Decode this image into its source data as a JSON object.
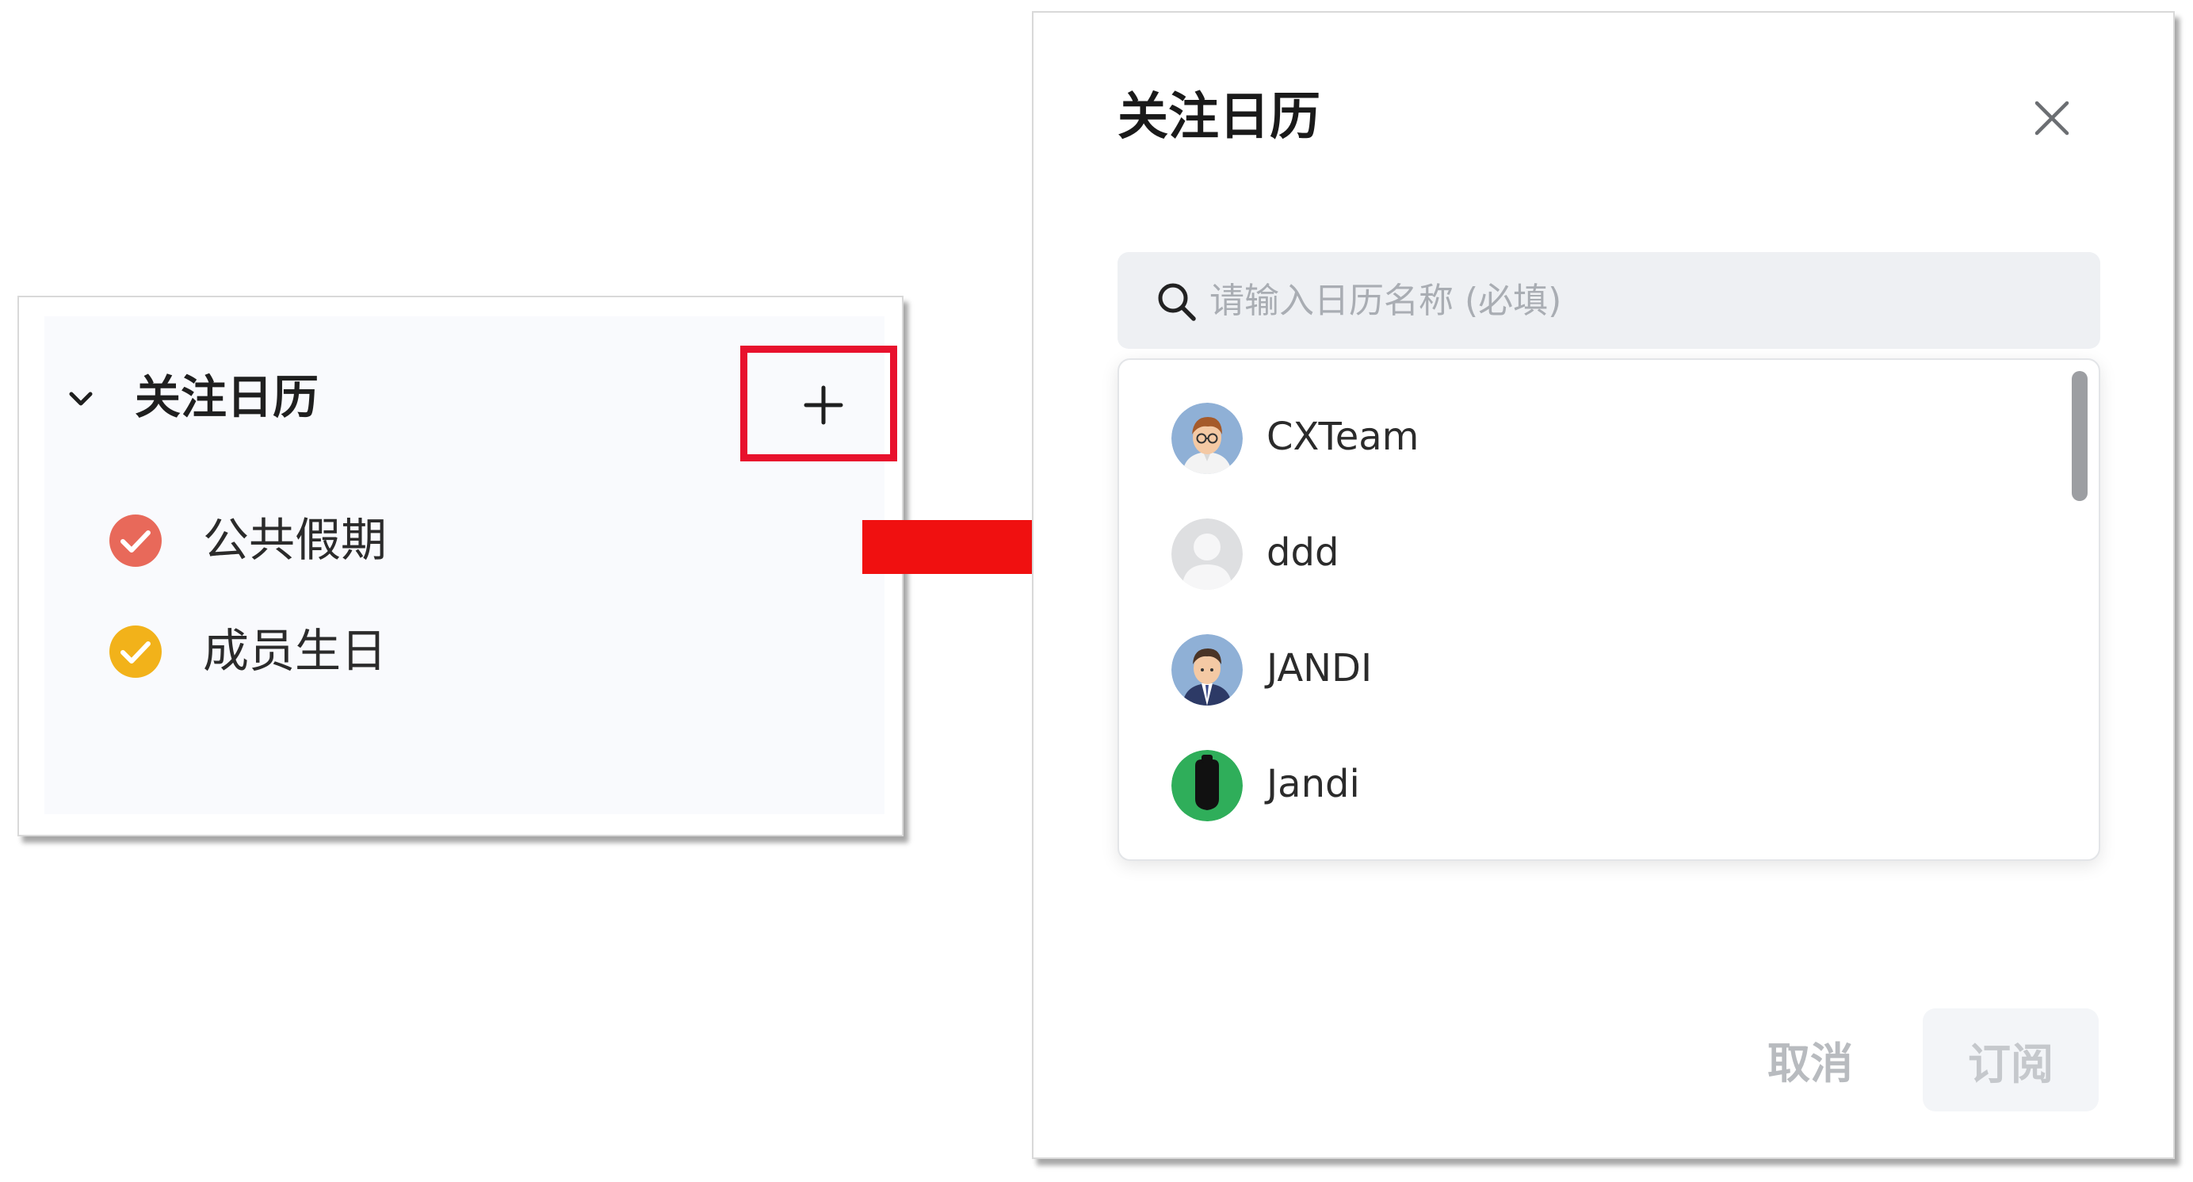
{
  "left_panel": {
    "section_title": "关注日历",
    "items": [
      {
        "label": "公共假期",
        "color": "#e8695a"
      },
      {
        "label": "成员生日",
        "color": "#f2b21a"
      }
    ]
  },
  "dialog": {
    "title": "关注日历",
    "search": {
      "placeholder": "请输入日历名称 (必填)",
      "value": ""
    },
    "calendars": [
      {
        "name": "CXTeam",
        "avatar": "person-glasses-avatar"
      },
      {
        "name": "ddd",
        "avatar": "default-gray-avatar"
      },
      {
        "name": "JANDI",
        "avatar": "person-suit-avatar"
      },
      {
        "name": "Jandi",
        "avatar": "jandi-logo-avatar"
      }
    ],
    "buttons": {
      "cancel": "取消",
      "subscribe": "订阅"
    }
  },
  "colors": {
    "highlight_box": "#e8112d",
    "arrow": "#f01010",
    "holiday_check": "#e8695a",
    "birthday_check": "#f2b21a"
  }
}
